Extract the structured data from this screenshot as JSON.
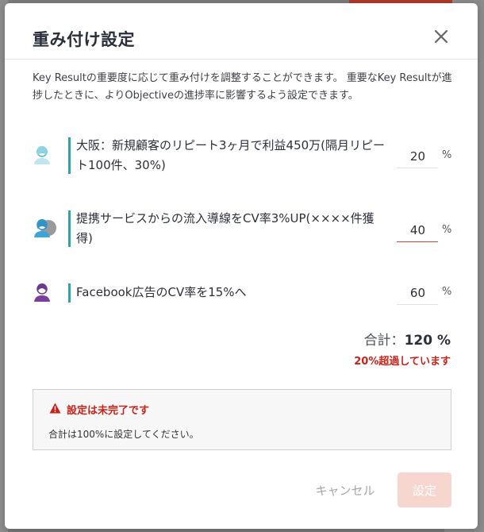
{
  "modal": {
    "title": "重み付け設定",
    "description": "Key Resultの重要度に応じて重み付けを調整することができます。 重要なKey Resultが進捗したときに、よりObjectiveの進捗率に影響するよう設定できます。"
  },
  "key_results": [
    {
      "title": "大阪：新規顧客のリピート3ヶ月で利益450万(隔月リピート100件、30%)",
      "weight": "20",
      "unit": "%"
    },
    {
      "title": "提携サービスからの流入導線をCV率3%UP(××××件獲得)",
      "weight": "40",
      "unit": "%"
    },
    {
      "title": "Facebook広告のCV率を15%へ",
      "weight": "60",
      "unit": "%"
    }
  ],
  "total": {
    "label": "合計：",
    "value": "120 %",
    "over_message": "20%超過しています"
  },
  "alert": {
    "title": "設定は未完了です",
    "body": "合計は100%に設定してください。"
  },
  "buttons": {
    "cancel": "キャンセル",
    "submit": "設定"
  },
  "colors": {
    "accent": "#2aa7a7",
    "error": "#c8231a",
    "submit_disabled": "#f8d6d0"
  },
  "icons": [
    "close-icon",
    "avatar-icon",
    "warning-icon"
  ]
}
